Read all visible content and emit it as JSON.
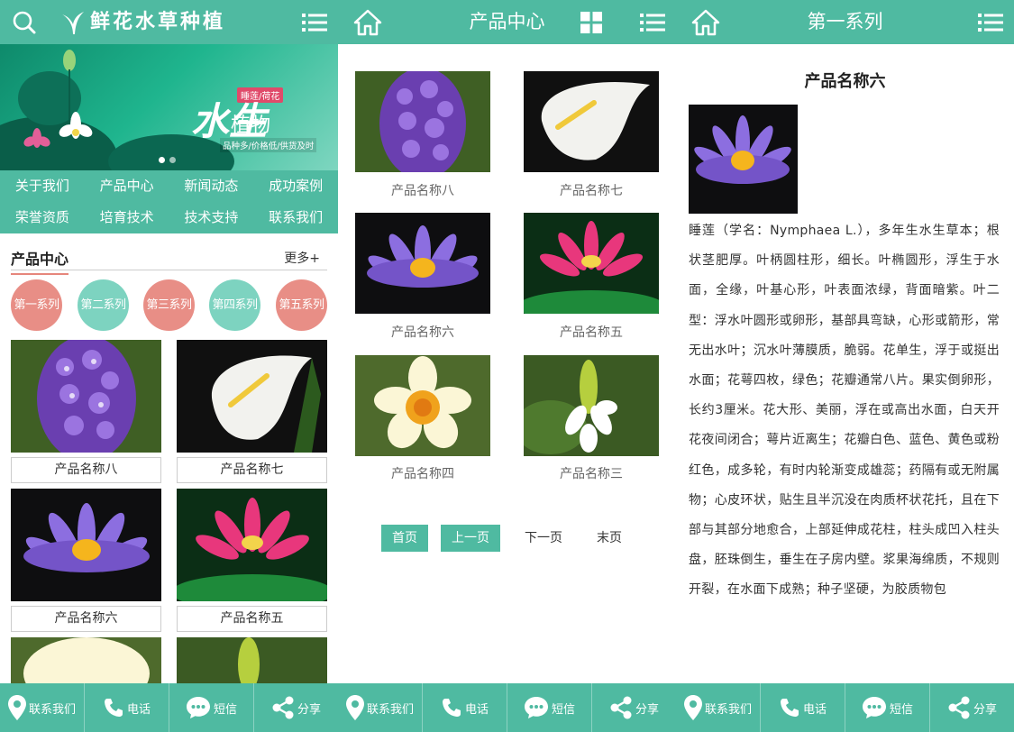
{
  "brand": {
    "logo_text": "鲜花水草种植"
  },
  "banner": {
    "tag": "睡莲/荷花",
    "headline_big": "水生",
    "headline": "植物",
    "sub": "品种多/价格低/供货及时"
  },
  "main_nav": [
    "关于我们",
    "产品中心",
    "新闻动态",
    "成功案例",
    "荣誉资质",
    "培育技术",
    "技术支持",
    "联系我们"
  ],
  "home_section": {
    "title": "产品中心",
    "more": "更多+"
  },
  "categories": [
    {
      "label": "第一系列",
      "color": "#e88e86"
    },
    {
      "label": "第二系列",
      "color": "#7dd3c0"
    },
    {
      "label": "第三系列",
      "color": "#e88e86"
    },
    {
      "label": "第四系列",
      "color": "#7dd3c0"
    },
    {
      "label": "第五系列",
      "color": "#e88e86"
    }
  ],
  "home_products": [
    "产品名称八",
    "产品名称七",
    "产品名称六",
    "产品名称五"
  ],
  "product_center": {
    "title": "产品中心",
    "items": [
      "产品名称八",
      "产品名称七",
      "产品名称六",
      "产品名称五",
      "产品名称四",
      "产品名称三"
    ],
    "pager": {
      "first": "首页",
      "prev": "上一页",
      "next": "下一页",
      "last": "末页"
    }
  },
  "detail": {
    "header": "第一系列",
    "title": "产品名称六",
    "body": "睡莲（学名：Nymphaea L.），多年生水生草本；根状茎肥厚。叶柄圆柱形，细长。叶椭圆形，浮生于水面，全缘，叶基心形，叶表面浓绿，背面暗紫。叶二型：浮水叶圆形或卵形，基部具弯缺，心形或箭形，常无出水叶；沉水叶薄膜质，脆弱。花单生，浮于或挺出水面；花萼四枚，绿色；花瓣通常八片。果实倒卵形，长约3厘米。花大形、美丽，浮在或高出水面，白天开花夜间闭合；萼片近离生；花瓣白色、蓝色、黄色或粉红色，成多轮，有时内轮渐变成雄蕊；药隔有或无附属物；心皮环状，贴生且半沉没在肉质杯状花托，且在下部与其部分地愈合，上部延伸成花柱，柱头成凹入柱头盘，胚珠倒生，垂生在子房内壁。浆果海绵质，不规则开裂，在水面下成熟；种子坚硬，为胶质物包"
  },
  "bottom_bar": [
    {
      "label": "联系我们",
      "icon": "location-pin-icon"
    },
    {
      "label": "电话",
      "icon": "phone-icon"
    },
    {
      "label": "短信",
      "icon": "sms-bubble-icon"
    },
    {
      "label": "分享",
      "icon": "share-icon"
    }
  ],
  "colors": {
    "theme": "#4fbaa1",
    "accent": "#e88e86",
    "accent2": "#7dd3c0"
  }
}
